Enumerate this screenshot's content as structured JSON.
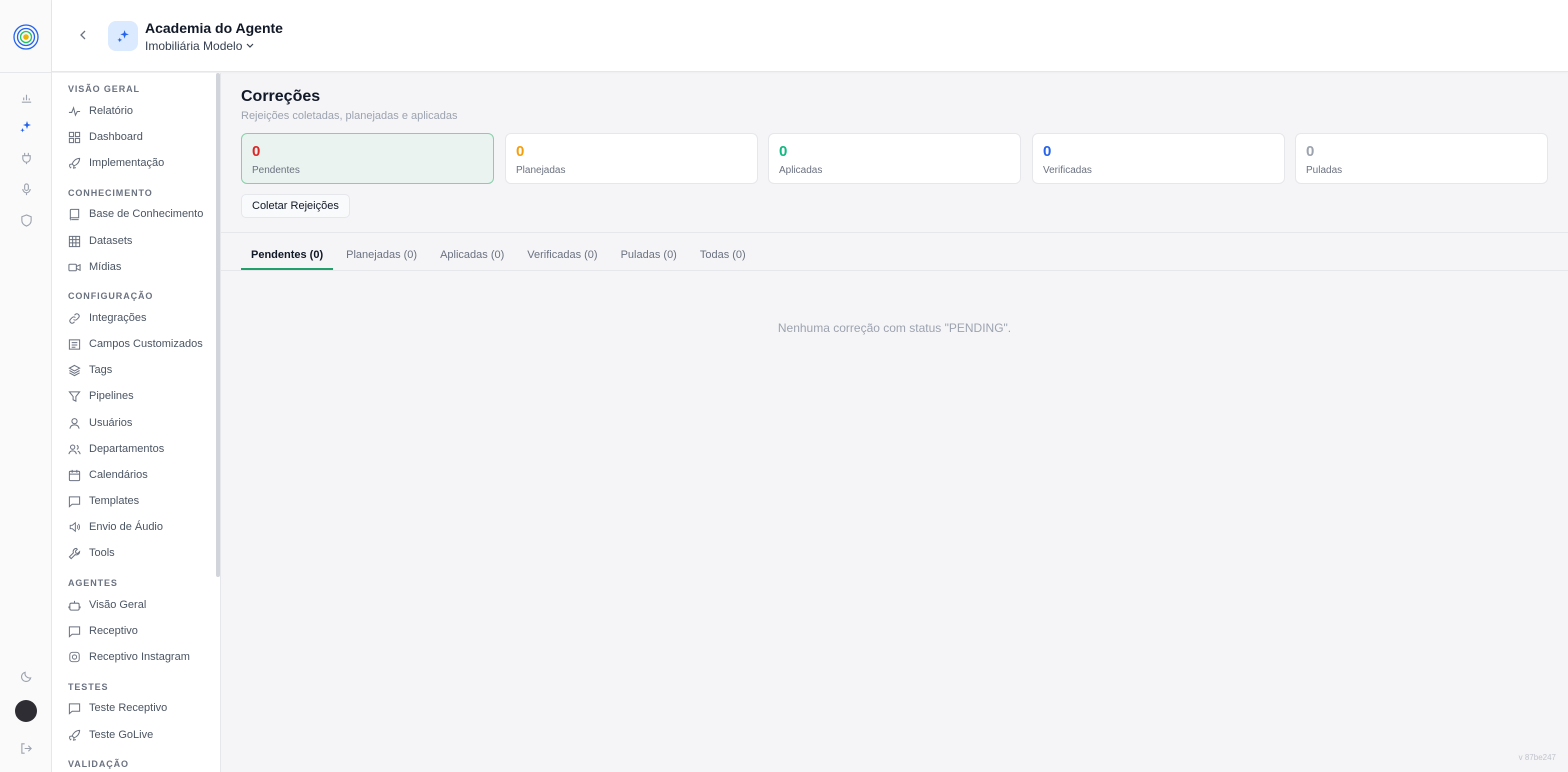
{
  "header": {
    "title": "Academia do Agente",
    "subtitle": "Imobiliária Modelo"
  },
  "rail": {
    "icons": [
      "bar-chart-icon",
      "sparkles-icon",
      "plug-icon",
      "microphone-icon",
      "shield-icon",
      "moon-icon",
      "logout-icon"
    ],
    "active": "sparkles-icon"
  },
  "sidebar": {
    "sections": [
      {
        "title": "VISÃO GERAL",
        "items": [
          {
            "label": "Relatório",
            "icon": "activity-icon"
          },
          {
            "label": "Dashboard",
            "icon": "grid-icon"
          },
          {
            "label": "Implementação",
            "icon": "rocket-icon"
          }
        ]
      },
      {
        "title": "CONHECIMENTO",
        "items": [
          {
            "label": "Base de Conhecimento",
            "icon": "book-icon"
          },
          {
            "label": "Datasets",
            "icon": "table-icon"
          },
          {
            "label": "Mídias",
            "icon": "video-icon"
          }
        ]
      },
      {
        "title": "CONFIGURAÇÃO",
        "items": [
          {
            "label": "Integrações",
            "icon": "link-icon"
          },
          {
            "label": "Campos Customizados",
            "icon": "form-icon"
          },
          {
            "label": "Tags",
            "icon": "layers-icon"
          },
          {
            "label": "Pipelines",
            "icon": "filter-icon"
          },
          {
            "label": "Usuários",
            "icon": "user-icon"
          },
          {
            "label": "Departamentos",
            "icon": "users-icon"
          },
          {
            "label": "Calendários",
            "icon": "calendar-icon"
          },
          {
            "label": "Templates",
            "icon": "message-icon"
          },
          {
            "label": "Envio de Áudio",
            "icon": "speaker-icon"
          },
          {
            "label": "Tools",
            "icon": "wrench-icon"
          }
        ]
      },
      {
        "title": "AGENTES",
        "items": [
          {
            "label": "Visão Geral",
            "icon": "bot-icon"
          },
          {
            "label": "Receptivo",
            "icon": "message-icon"
          },
          {
            "label": "Receptivo Instagram",
            "icon": "instagram-icon"
          }
        ]
      },
      {
        "title": "TESTES",
        "items": [
          {
            "label": "Teste Receptivo",
            "icon": "message-icon"
          },
          {
            "label": "Teste GoLive",
            "icon": "rocket-icon"
          }
        ]
      },
      {
        "title": "VALIDAÇÃO",
        "items": []
      }
    ]
  },
  "main": {
    "title": "Correções",
    "subtitle": "Rejeições coletadas, planejadas e aplicadas",
    "stats": [
      {
        "value": "0",
        "label": "Pendentes",
        "color": "#dc2626"
      },
      {
        "value": "0",
        "label": "Planejadas",
        "color": "#f59e0b"
      },
      {
        "value": "0",
        "label": "Aplicadas",
        "color": "#10b981"
      },
      {
        "value": "0",
        "label": "Verificadas",
        "color": "#2563eb"
      },
      {
        "value": "0",
        "label": "Puladas",
        "color": "#9ca3af"
      }
    ],
    "collect_button": "Coletar Rejeições",
    "tabs": [
      {
        "label": "Pendentes (0)",
        "active": true
      },
      {
        "label": "Planejadas (0)"
      },
      {
        "label": "Aplicadas (0)"
      },
      {
        "label": "Verificadas (0)"
      },
      {
        "label": "Puladas (0)"
      },
      {
        "label": "Todas (0)"
      }
    ],
    "empty_message": "Nenhuma correção com status \"PENDING\".",
    "version": "v 87be247"
  }
}
